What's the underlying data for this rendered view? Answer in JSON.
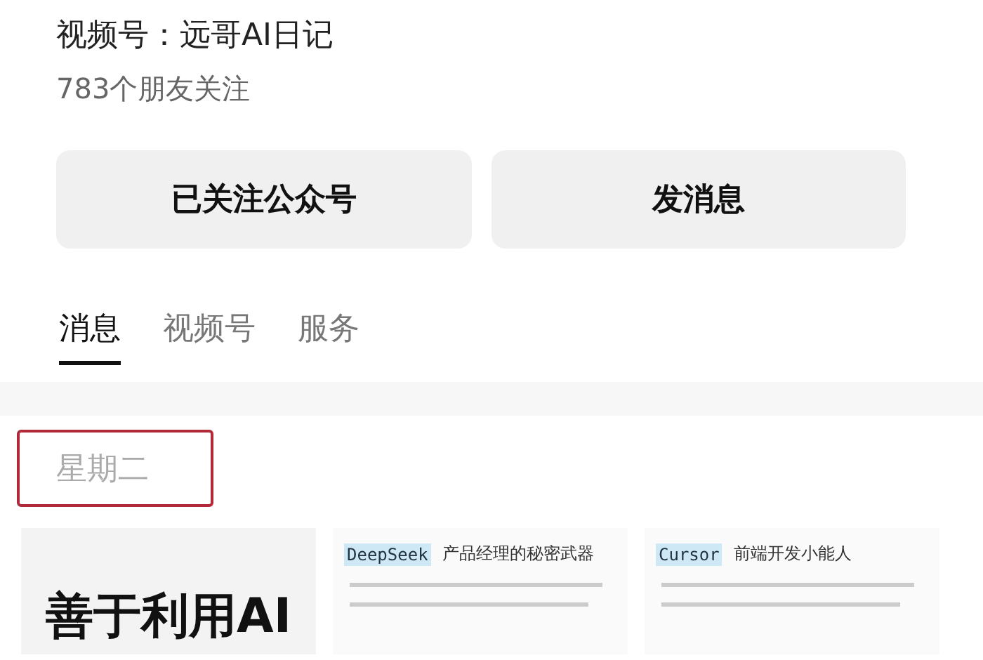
{
  "profile": {
    "channel": "视频号：远哥AI日记",
    "followers": "783个朋友关注"
  },
  "buttons": [
    {
      "label": "已关注公众号"
    },
    {
      "label": "发消息"
    }
  ],
  "tabs": [
    {
      "label": "消息",
      "selected": true
    },
    {
      "label": "视频号",
      "selected": false
    },
    {
      "label": "服务",
      "selected": false
    }
  ],
  "date_label": "星期二",
  "articles": [
    {
      "kind": "cover",
      "title": "善于利用AI"
    },
    {
      "kind": "doc",
      "tag": "DeepSeek",
      "title": "产品经理的秘密武器"
    },
    {
      "kind": "doc",
      "tag": "Cursor",
      "title": "前端开发小能人"
    }
  ]
}
